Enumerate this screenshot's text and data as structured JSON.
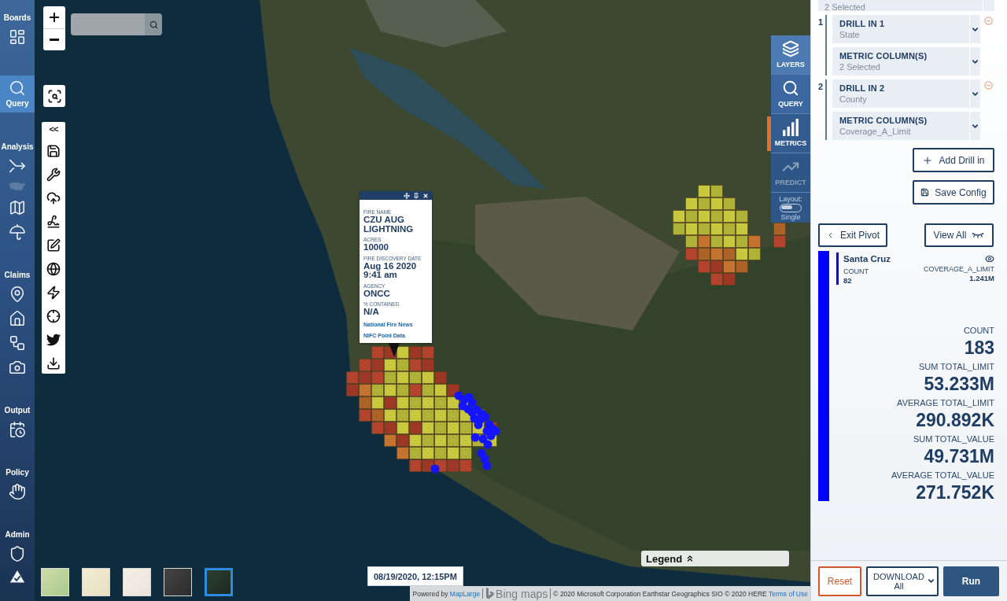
{
  "sidebar": {
    "sections": [
      {
        "label": "Boards",
        "selected": false,
        "tools": [
          {
            "disabled": false
          }
        ]
      },
      {
        "label": "Query",
        "selected": true,
        "tools": [
          {
            "disabled": false
          }
        ]
      },
      {
        "label": "Analysis",
        "selected": false,
        "tools": [
          {
            "disabled": false
          },
          {
            "disabled": true
          },
          {
            "disabled": false
          },
          {
            "disabled": false
          }
        ]
      },
      {
        "label": "Claims",
        "selected": false,
        "tools": [
          {
            "disabled": false
          },
          {
            "disabled": false
          },
          {
            "disabled": false
          },
          {
            "disabled": false
          }
        ]
      },
      {
        "label": "Output",
        "selected": false,
        "tools": [
          {
            "disabled": false
          }
        ]
      },
      {
        "label": "Policy",
        "selected": false,
        "tools": [
          {
            "disabled": false
          }
        ]
      },
      {
        "label": "Admin",
        "selected": false,
        "tools": [
          {
            "disabled": false
          },
          {
            "disabled": false
          }
        ]
      }
    ]
  },
  "map_tools": {
    "collapse_label": "<<"
  },
  "popup": {
    "fields": [
      {
        "label": "FIRE NAME",
        "value": "CZU AUG LIGHTNING"
      },
      {
        "label": "ACRES",
        "value": "10000"
      },
      {
        "label": "FIRE DISCOVERY DATE",
        "value": "Aug 16 2020 9:41 am"
      },
      {
        "label": "AGENCY",
        "value": "ONCC"
      },
      {
        "label": "% CONTAINED",
        "value": "N/A"
      }
    ],
    "links": [
      "National Fire News",
      "NIFC Point Data"
    ]
  },
  "basemaps": [
    {
      "selected": false
    },
    {
      "selected": false
    },
    {
      "selected": false
    },
    {
      "selected": false
    },
    {
      "selected": true
    }
  ],
  "timestamp": "08/19/2020, 12:15PM",
  "legend": {
    "label": "Legend"
  },
  "attribution": {
    "powered_by": "Powered by",
    "provider": "MapLarge",
    "logo": "Bing maps",
    "copyright": "© 2020 Microsoft Corporation Earthstar Geographics SIO © 2020 HERE",
    "terms": "Terms of Use"
  },
  "layer_panel": {
    "tabs": [
      {
        "label": "LAYERS",
        "selected": false,
        "disabled": false
      },
      {
        "label": "QUERY",
        "selected": false,
        "disabled": false
      },
      {
        "label": "METRICS",
        "selected": true,
        "disabled": false
      },
      {
        "label": "PREDICT",
        "selected": false,
        "disabled": true
      }
    ],
    "layout": {
      "label": "Layout:",
      "value": "Single",
      "on": false
    }
  },
  "pivot": {
    "top_field": "2 Selected",
    "drills": [
      {
        "number": "1",
        "fields": [
          {
            "label": "DRILL IN 1",
            "value": "State"
          },
          {
            "label": "METRIC COLUMN(S)",
            "value": "2 Selected"
          }
        ]
      },
      {
        "number": "2",
        "fields": [
          {
            "label": "DRILL IN 2",
            "value": "County"
          },
          {
            "label": "METRIC COLUMN(S)",
            "value": "Coverage_A_Limit"
          }
        ]
      }
    ],
    "add_button": "Add Drill in",
    "save_button": "Save Config",
    "exit_button": "Exit Pivot",
    "view_all_button": "View All"
  },
  "results": {
    "groups": [
      {
        "name": "Santa Cruz",
        "color": "#0000ff",
        "metrics": [
          {
            "label": "COUNT",
            "value": "82"
          },
          {
            "label": "COVERAGE_A_LIMIT",
            "value": "1.241M"
          }
        ]
      }
    ],
    "totals": [
      {
        "label": "COUNT",
        "value": "183"
      },
      {
        "label": "SUM TOTAL_LIMIT",
        "value": "53.233M"
      },
      {
        "label": "AVERAGE TOTAL_LIMIT",
        "value": "290.892K"
      },
      {
        "label": "SUM TOTAL_VALUE",
        "value": "49.731M"
      },
      {
        "label": "AVERAGE TOTAL_VALUE",
        "value": "271.752K"
      }
    ]
  },
  "footer": {
    "reset": "Reset",
    "download": {
      "label": "DOWNLOAD",
      "value": "All"
    },
    "run": "Run"
  }
}
